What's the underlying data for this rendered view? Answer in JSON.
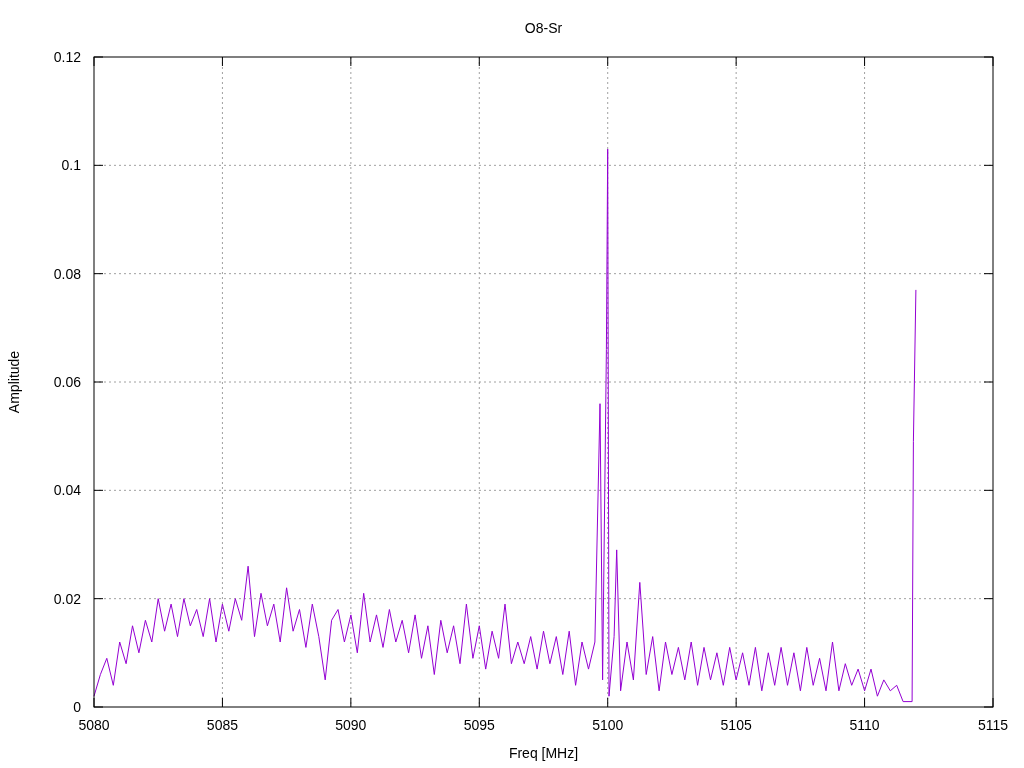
{
  "chart_data": {
    "type": "line",
    "title": "O8-Sr",
    "grid": true,
    "xlabel": "Freq [MHz]",
    "ylabel": "Amplitude",
    "xlim": [
      5080,
      5115
    ],
    "ylim": [
      0,
      0.12
    ],
    "xticks": [
      5080,
      5085,
      5090,
      5095,
      5100,
      5105,
      5110,
      5115
    ],
    "yticks": [
      {
        "value": 0,
        "label": "0"
      },
      {
        "value": 0.02,
        "label": "0.02"
      },
      {
        "value": 0.04,
        "label": "0.04"
      },
      {
        "value": 0.06,
        "label": "0.06"
      },
      {
        "value": 0.08,
        "label": "0.08"
      },
      {
        "value": 0.1,
        "label": "0.1"
      },
      {
        "value": 0.12,
        "label": "0.12"
      }
    ],
    "x": [
      5080,
      5080.25,
      5080.5,
      5080.75,
      5081,
      5081.25,
      5081.5,
      5081.75,
      5082,
      5082.25,
      5082.5,
      5082.75,
      5083,
      5083.25,
      5083.5,
      5083.75,
      5084,
      5084.25,
      5084.5,
      5084.75,
      5085,
      5085.25,
      5085.5,
      5085.75,
      5086,
      5086.25,
      5086.5,
      5086.75,
      5087,
      5087.25,
      5087.5,
      5087.75,
      5088,
      5088.25,
      5088.5,
      5088.75,
      5089,
      5089.25,
      5089.5,
      5089.75,
      5090,
      5090.25,
      5090.5,
      5090.75,
      5091,
      5091.25,
      5091.5,
      5091.75,
      5092,
      5092.25,
      5092.5,
      5092.75,
      5093,
      5093.25,
      5093.5,
      5093.75,
      5094,
      5094.25,
      5094.5,
      5094.75,
      5095,
      5095.25,
      5095.5,
      5095.75,
      5096,
      5096.25,
      5096.5,
      5096.75,
      5097,
      5097.25,
      5097.5,
      5097.75,
      5098,
      5098.25,
      5098.5,
      5098.75,
      5099,
      5099.25,
      5099.5,
      5099.7,
      5099.8,
      5099.95,
      5100,
      5100.05,
      5100.25,
      5100.35,
      5100.5,
      5100.75,
      5101,
      5101.25,
      5101.5,
      5101.75,
      5102,
      5102.25,
      5102.5,
      5102.75,
      5103,
      5103.25,
      5103.5,
      5103.75,
      5104,
      5104.25,
      5104.5,
      5104.75,
      5105,
      5105.25,
      5105.5,
      5105.75,
      5106,
      5106.25,
      5106.5,
      5106.75,
      5107,
      5107.25,
      5107.5,
      5107.75,
      5108,
      5108.25,
      5108.5,
      5108.75,
      5109,
      5109.25,
      5109.5,
      5109.75,
      5110,
      5110.25,
      5110.5,
      5110.75,
      5111,
      5111.25,
      5111.5,
      5111.85,
      5111.9,
      5112
    ],
    "series": [
      {
        "color": "#9400d3",
        "values": [
          0.002,
          0.006,
          0.009,
          0.004,
          0.012,
          0.008,
          0.015,
          0.01,
          0.016,
          0.012,
          0.02,
          0.014,
          0.019,
          0.013,
          0.02,
          0.015,
          0.018,
          0.013,
          0.02,
          0.012,
          0.019,
          0.014,
          0.02,
          0.016,
          0.026,
          0.013,
          0.021,
          0.015,
          0.019,
          0.012,
          0.022,
          0.014,
          0.018,
          0.011,
          0.019,
          0.013,
          0.005,
          0.016,
          0.018,
          0.012,
          0.017,
          0.01,
          0.021,
          0.012,
          0.017,
          0.011,
          0.018,
          0.012,
          0.016,
          0.01,
          0.017,
          0.009,
          0.015,
          0.006,
          0.016,
          0.01,
          0.015,
          0.008,
          0.019,
          0.009,
          0.015,
          0.007,
          0.014,
          0.009,
          0.019,
          0.008,
          0.012,
          0.008,
          0.013,
          0.007,
          0.014,
          0.008,
          0.013,
          0.006,
          0.014,
          0.004,
          0.012,
          0.007,
          0.012,
          0.056,
          0.005,
          0.066,
          0.103,
          0.002,
          0.013,
          0.029,
          0.003,
          0.012,
          0.005,
          0.023,
          0.006,
          0.013,
          0.003,
          0.012,
          0.006,
          0.011,
          0.005,
          0.012,
          0.004,
          0.011,
          0.005,
          0.01,
          0.004,
          0.011,
          0.005,
          0.01,
          0.004,
          0.011,
          0.003,
          0.01,
          0.004,
          0.011,
          0.004,
          0.01,
          0.003,
          0.011,
          0.004,
          0.009,
          0.003,
          0.012,
          0.003,
          0.008,
          0.004,
          0.007,
          0.003,
          0.007,
          0.002,
          0.005,
          0.003,
          0.004,
          0.001,
          0.001,
          0.049,
          0.077
        ]
      }
    ]
  }
}
